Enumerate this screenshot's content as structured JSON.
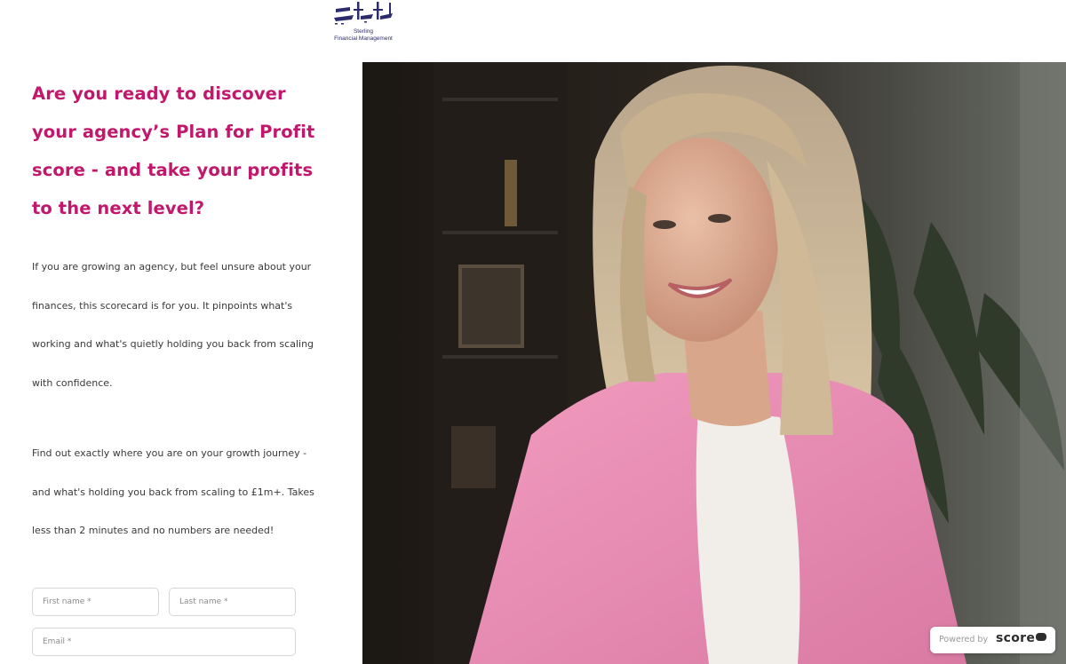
{
  "header": {
    "logo_name": "Sterling",
    "logo_sub": "Financial Management"
  },
  "hero": {
    "headline_lines": [
      " Are you ready to discover",
      "your agency’s Plan for Profit",
      "score - and take your profits",
      "to the next level?"
    ],
    "para1_lines": [
      "If you are growing an agency, but feel unsure about your",
      "finances, this scorecard is for you.  It pinpoints what's",
      "working and what's quietly holding you back from scaling",
      "with confidence."
    ],
    "para2_lines": [
      "Find out exactly where you are on your growth journey -",
      "and what's holding you back from scaling to £1m+.  Takes",
      "less than 2 minutes and no numbers are needed!"
    ]
  },
  "form": {
    "first_name_placeholder": "First name *",
    "last_name_placeholder": "Last name *",
    "email_placeholder": "Email *"
  },
  "badge": {
    "label": "Powered by",
    "brand": "score"
  },
  "colors": {
    "accent": "#c2186c",
    "blazer": "#e88ab1",
    "text": "#3a3a3a"
  }
}
